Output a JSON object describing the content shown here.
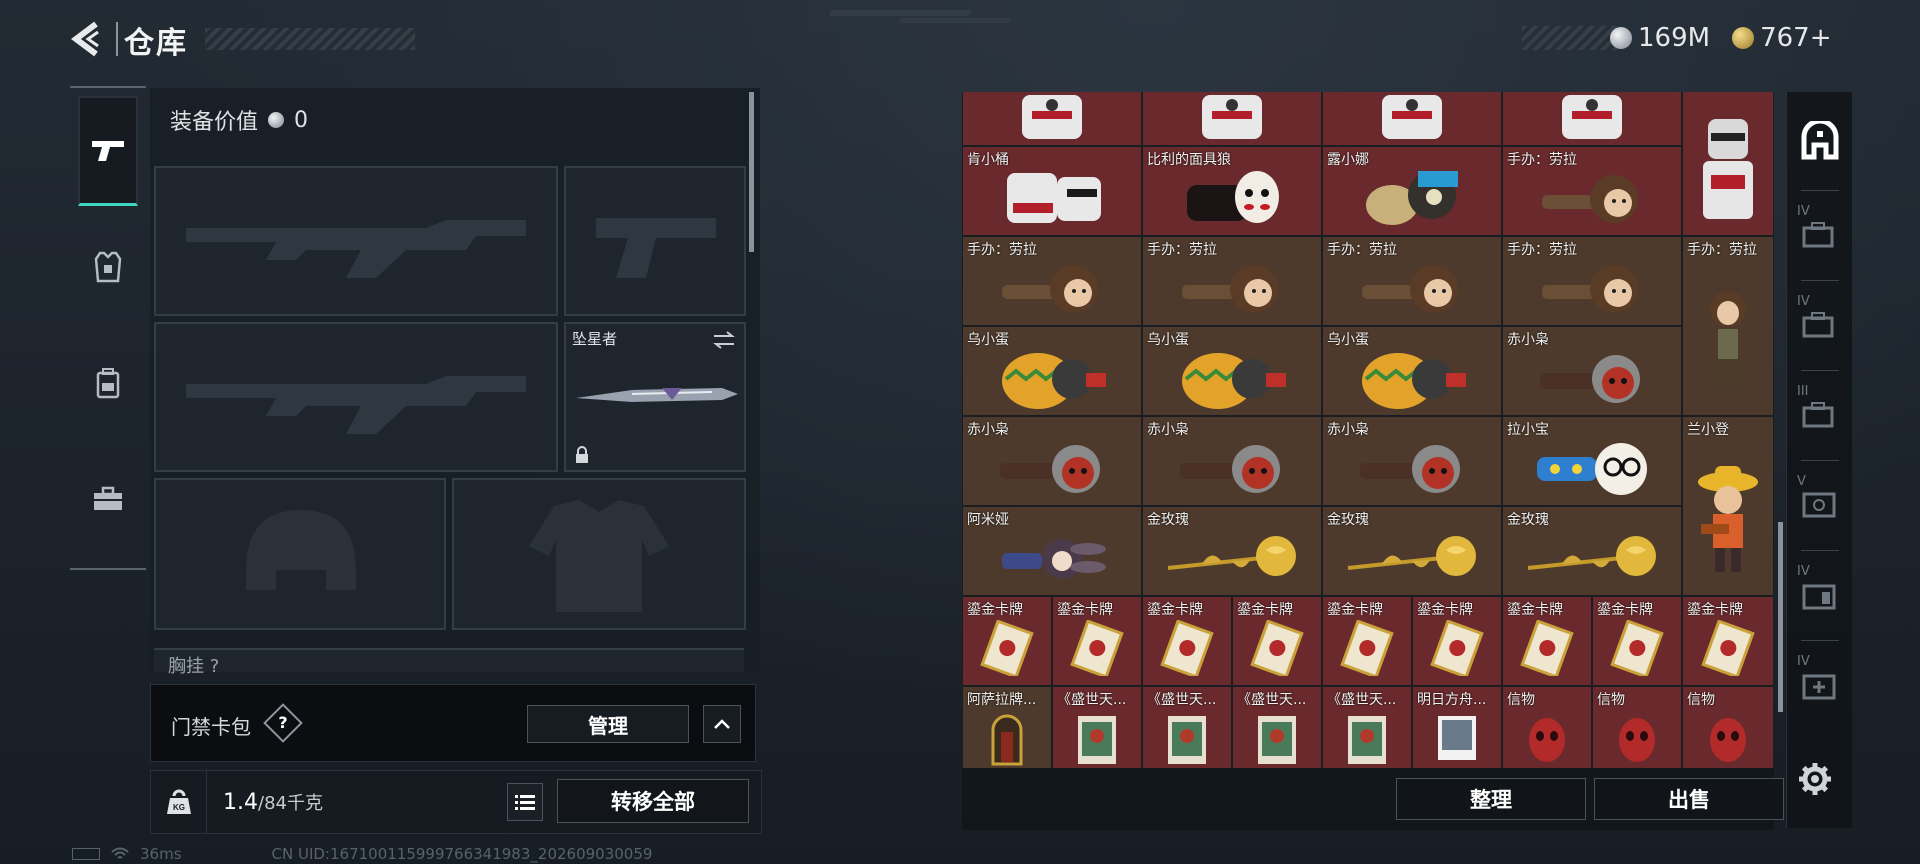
{
  "header": {
    "title": "仓库",
    "currencies": [
      {
        "name": "silver-coin",
        "value": "169M",
        "color": "#c8ccd1"
      },
      {
        "name": "gold-coin",
        "value": "767+",
        "color": "#d8b24a"
      }
    ]
  },
  "left_rail": [
    {
      "icon": "pistol-icon",
      "active": true
    },
    {
      "icon": "vest-icon",
      "active": false
    },
    {
      "icon": "backpack-icon",
      "active": false
    },
    {
      "icon": "case-icon",
      "active": false
    }
  ],
  "equipment": {
    "value_label": "装备价值",
    "value": "0",
    "melee_name": "坠星者",
    "next_section": "胸挂 ?"
  },
  "keycard": {
    "label": "门禁卡包",
    "help": "?",
    "manage_label": "管理",
    "toggle_glyph": "^"
  },
  "weight": {
    "current": "1.4",
    "max": "/84千克",
    "list_icon": "list-icon",
    "move_all_label": "转移全部"
  },
  "status_bar": {
    "ping": "36ms",
    "uid": "CN UID:16710011599976634198​3_202609030059"
  },
  "inventory": {
    "rows": [
      [
        "",
        "",
        "",
        "",
        ""
      ],
      [
        "肯小桶",
        "比利的面具狼",
        "露小娜",
        "手办：劳拉",
        ""
      ],
      [
        "手办：劳拉",
        "手办：劳拉",
        "手办：劳拉",
        "手办：劳拉",
        "手办：劳拉"
      ],
      [
        "乌小蛋",
        "乌小蛋",
        "乌小蛋",
        "赤小枭",
        ""
      ],
      [
        "赤小枭",
        "赤小枭",
        "赤小枭",
        "拉小宝",
        "兰小登"
      ],
      [
        "阿米娅",
        "金玫瑰",
        "金玫瑰",
        "金玫瑰",
        ""
      ]
    ],
    "cards": [
      "鎏金卡牌",
      "鎏金卡牌",
      "鎏金卡牌",
      "鎏金卡牌",
      "鎏金卡牌",
      "鎏金卡牌",
      "鎏金卡牌",
      "鎏金卡牌",
      "鎏金卡牌"
    ],
    "bottom": [
      "阿萨拉牌...",
      "《盛世天...",
      "《盛世天...",
      "《盛世天...",
      "《盛世天...",
      "明日方舟...",
      "信物",
      "信物",
      "信物"
    ],
    "sort_label": "整理",
    "sell_label": "出售"
  },
  "right_rail": {
    "tiers": [
      "IV",
      "IV",
      "III",
      "V",
      "IV",
      "IV"
    ],
    "settings_icon": "gear-icon"
  }
}
